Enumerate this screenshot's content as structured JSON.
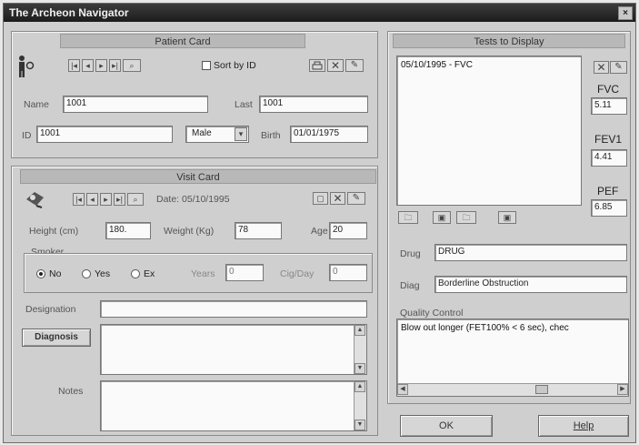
{
  "window": {
    "title": "The Archeon Navigator",
    "close_glyph": "×"
  },
  "patient_card": {
    "header": "Patient Card",
    "sort_label": "Sort by ID",
    "name_label": "Name",
    "name_value": "1001",
    "last_label": "Last",
    "last_value": "1001",
    "id_label": "ID",
    "id_value": "1001",
    "sex_value": "Male",
    "birth_label": "Birth",
    "birth_value": "01/01/1975"
  },
  "visit_card": {
    "header": "Visit Card",
    "date_label": "Date: 05/10/1995",
    "height_label": "Height (cm)",
    "height_value": "180.",
    "weight_label": "Weight (Kg)",
    "weight_value": "78",
    "age_label": "Age",
    "age_value": "20",
    "smoker_label": "Smoker",
    "smoker_options": [
      "No",
      "Yes",
      "Ex"
    ],
    "smoker_selected": "No",
    "years_label": "Years",
    "years_value": "0",
    "cigday_label": "Cig/Day",
    "cigday_value": "0",
    "designation_label": "Designation",
    "designation_value": "",
    "diagnosis_button": "Diagnosis",
    "notes_label": "Notes"
  },
  "tests": {
    "header": "Tests to Display",
    "list": [
      "05/10/1995 - FVC"
    ],
    "fvc_label": "FVC",
    "fvc_value": "5.11",
    "fev1_label": "FEV1",
    "fev1_value": "4.41",
    "pef_label": "PEF",
    "pef_value": "6.85",
    "drug_label": "Drug",
    "drug_value": "DRUG",
    "diag_label": "Diag",
    "diag_value": "Borderline Obstruction",
    "quality_label": "Quality Control",
    "quality_text": "Blow out longer (FET100% < 6 sec), chec"
  },
  "footer": {
    "ok": "OK",
    "help": "Help"
  },
  "nav_glyphs": {
    "first": "|◂",
    "prev": "◂",
    "next": "▸",
    "last": "▸|",
    "search": "⌕"
  }
}
